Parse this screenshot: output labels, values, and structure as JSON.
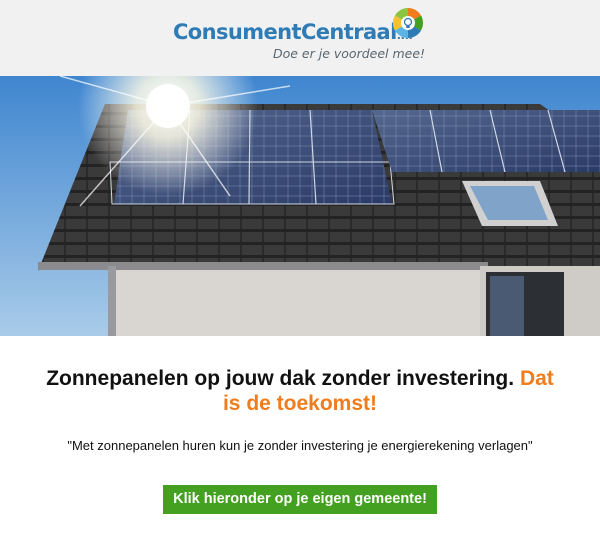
{
  "header": {
    "logo_brand": "ConsumentCentraal",
    "logo_tld": ".nl",
    "logo_tagline": "Doe er je voordeel mee!"
  },
  "main": {
    "headline_part1": "Zonnepanelen op jouw dak zonder investering.",
    "headline_accent": "Dat is de toekomst!",
    "quote": "\"Met zonnepanelen huren kun je zonder investering je energierekening verlagen\"",
    "cta_label": "Klik hieronder op je eigen gemeente!"
  },
  "colors": {
    "brand_blue": "#2e7bb5",
    "accent_orange": "#f07c1c",
    "cta_green": "#44a021",
    "header_bg": "#f1f1f1"
  }
}
